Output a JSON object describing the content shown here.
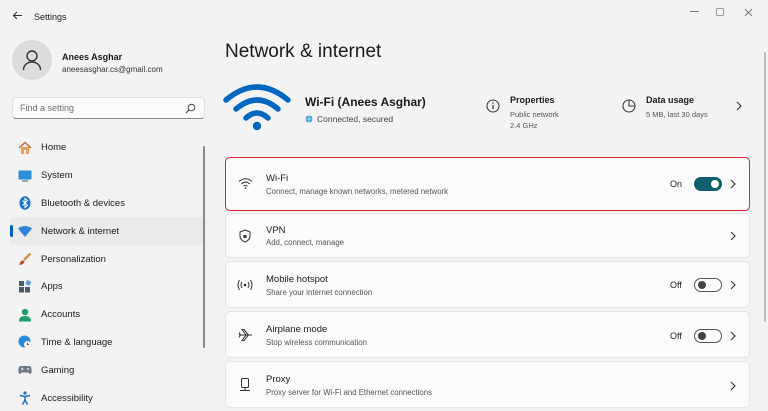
{
  "window": {
    "title": "Settings",
    "back_icon": "back-arrow-icon",
    "controls": [
      "minimize-icon",
      "maximize-icon",
      "close-icon"
    ]
  },
  "profile": {
    "name": "Anees Asghar",
    "email": "aneesasghar.cs@gmail.com"
  },
  "search": {
    "placeholder": "Find a setting"
  },
  "sidebar": {
    "items": [
      {
        "label": "Home",
        "icon": "home-icon",
        "active": false
      },
      {
        "label": "System",
        "icon": "system-icon",
        "active": false
      },
      {
        "label": "Bluetooth & devices",
        "icon": "bluetooth-icon",
        "active": false
      },
      {
        "label": "Network & internet",
        "icon": "network-icon",
        "active": true
      },
      {
        "label": "Personalization",
        "icon": "brush-icon",
        "active": false
      },
      {
        "label": "Apps",
        "icon": "apps-icon",
        "active": false
      },
      {
        "label": "Accounts",
        "icon": "accounts-icon",
        "active": false
      },
      {
        "label": "Time & language",
        "icon": "globe-clock-icon",
        "active": false
      },
      {
        "label": "Gaming",
        "icon": "gamepad-icon",
        "active": false
      },
      {
        "label": "Accessibility",
        "icon": "accessibility-icon",
        "active": false
      }
    ]
  },
  "main": {
    "title": "Network & internet",
    "hero": {
      "name": "Wi-Fi (Anees Asghar)",
      "status": "Connected, secured",
      "properties": {
        "title": "Properties",
        "line1": "Public network",
        "line2": "2.4 GHz"
      },
      "data_usage": {
        "title": "Data usage",
        "line1": "5 MB, last 30 days"
      }
    },
    "cards": [
      {
        "title": "Wi-Fi",
        "subtitle": "Connect, manage known networks, metered network",
        "icon": "wifi-icon",
        "toggle": "On",
        "toggle_on": true,
        "highlighted": true
      },
      {
        "title": "VPN",
        "subtitle": "Add, connect, manage",
        "icon": "vpn-shield-icon"
      },
      {
        "title": "Mobile hotspot",
        "subtitle": "Share your internet connection",
        "icon": "hotspot-icon",
        "toggle": "Off",
        "toggle_on": false
      },
      {
        "title": "Airplane mode",
        "subtitle": "Stop wireless communication",
        "icon": "airplane-icon",
        "toggle": "Off",
        "toggle_on": false
      },
      {
        "title": "Proxy",
        "subtitle": "Proxy server for Wi-Fi and Ethernet connections",
        "icon": "proxy-icon"
      }
    ]
  },
  "colors": {
    "accent": "#005fb8",
    "wifi_blue": "#0067c0",
    "toggle_on": "#0f5f6e",
    "highlight_border": "#e0242b"
  }
}
